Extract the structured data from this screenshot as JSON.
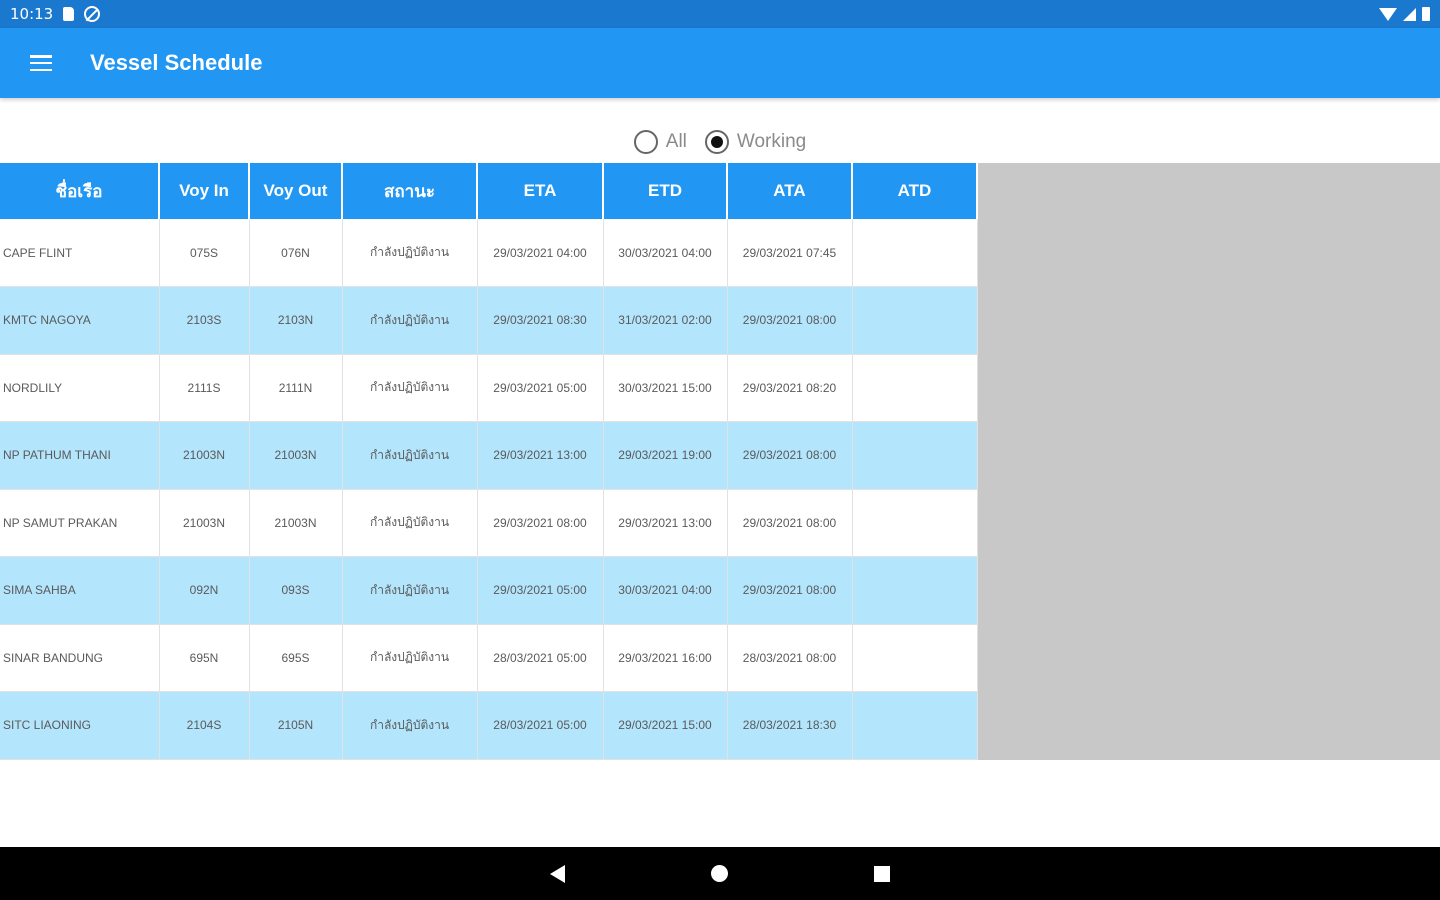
{
  "status_bar": {
    "time": "10:13",
    "icons": [
      "sd-card-icon",
      "no-access-icon",
      "wifi-icon",
      "signal-icon",
      "battery-icon"
    ]
  },
  "app_bar": {
    "title": "Vessel Schedule",
    "menu_icon": "menu-icon"
  },
  "filter": {
    "options": [
      {
        "label": "All",
        "selected": false
      },
      {
        "label": "Working",
        "selected": true
      }
    ]
  },
  "table": {
    "headers": [
      "ชื่อเรือ",
      "Voy In",
      "Voy Out",
      "สถานะ",
      "ETA",
      "ETD",
      "ATA",
      "ATD"
    ],
    "rows": [
      {
        "vessel": "CAPE FLINT",
        "voy_in": "075S",
        "voy_out": "076N",
        "status": "กำลังปฏิบัติงาน",
        "eta": "29/03/2021 04:00",
        "etd": "30/03/2021 04:00",
        "ata": "29/03/2021 07:45",
        "atd": ""
      },
      {
        "vessel": "KMTC NAGOYA",
        "voy_in": "2103S",
        "voy_out": "2103N",
        "status": "กำลังปฏิบัติงาน",
        "eta": "29/03/2021 08:30",
        "etd": "31/03/2021 02:00",
        "ata": "29/03/2021 08:00",
        "atd": ""
      },
      {
        "vessel": "NORDLILY",
        "voy_in": "2111S",
        "voy_out": "2111N",
        "status": "กำลังปฏิบัติงาน",
        "eta": "29/03/2021 05:00",
        "etd": "30/03/2021 15:00",
        "ata": "29/03/2021 08:20",
        "atd": ""
      },
      {
        "vessel": "NP PATHUM THANI",
        "voy_in": "21003N",
        "voy_out": "21003N",
        "status": "กำลังปฏิบัติงาน",
        "eta": "29/03/2021 13:00",
        "etd": "29/03/2021 19:00",
        "ata": "29/03/2021 08:00",
        "atd": ""
      },
      {
        "vessel": "NP SAMUT PRAKAN",
        "voy_in": "21003N",
        "voy_out": "21003N",
        "status": "กำลังปฏิบัติงาน",
        "eta": "29/03/2021 08:00",
        "etd": "29/03/2021 13:00",
        "ata": "29/03/2021 08:00",
        "atd": ""
      },
      {
        "vessel": "SIMA SAHBA",
        "voy_in": "092N",
        "voy_out": "093S",
        "status": "กำลังปฏิบัติงาน",
        "eta": "29/03/2021 05:00",
        "etd": "30/03/2021 04:00",
        "ata": "29/03/2021 08:00",
        "atd": ""
      },
      {
        "vessel": "SINAR BANDUNG",
        "voy_in": "695N",
        "voy_out": "695S",
        "status": "กำลังปฏิบัติงาน",
        "eta": "28/03/2021 05:00",
        "etd": "29/03/2021 16:00",
        "ata": "28/03/2021 08:00",
        "atd": ""
      },
      {
        "vessel": "SITC LIAONING",
        "voy_in": "2104S",
        "voy_out": "2105N",
        "status": "กำลังปฏิบัติงาน",
        "eta": "28/03/2021 05:00",
        "etd": "29/03/2021 15:00",
        "ata": "28/03/2021 18:30",
        "atd": ""
      }
    ]
  },
  "nav_bar": {
    "icons": [
      "back-icon",
      "home-icon",
      "recents-icon"
    ]
  },
  "colors": {
    "status_bar": "#1a78cf",
    "app_bar": "#2196f3",
    "header": "#2196f3",
    "row_alt": "#b3e5fc",
    "empty_area": "#c8c8c8"
  }
}
